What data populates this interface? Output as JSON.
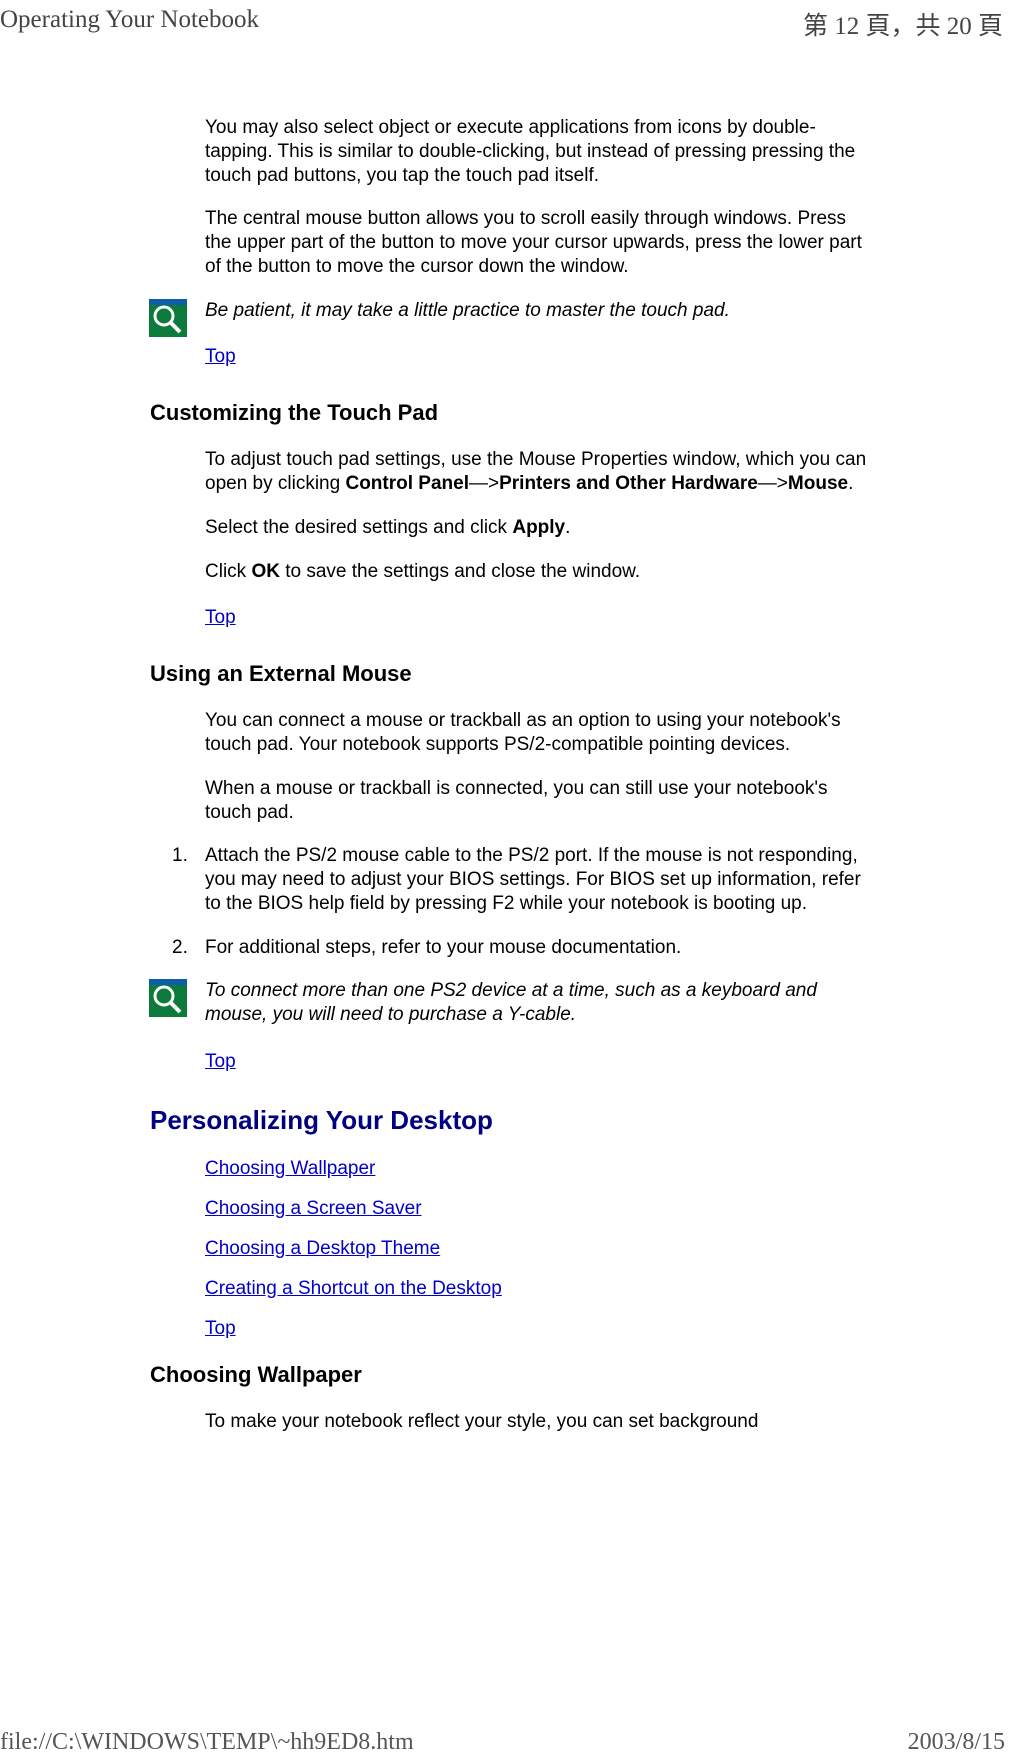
{
  "header": {
    "title": "Operating Your Notebook",
    "pageInfo": "第 12 頁，共 20 頁"
  },
  "intro": {
    "p1": "You may also select object or execute applications from icons by double-tapping. This is similar to double-clicking, but instead of pressing pressing the touch pad buttons, you tap the touch pad itself.",
    "p2": "The central mouse button allows you to scroll easily through windows. Press the upper part of the button to move your cursor upwards, press the lower part of the button to move the cursor down the window.",
    "note": "Be patient, it may take a little practice to master the touch pad.",
    "topLink": "Top"
  },
  "customizing": {
    "heading": "Customizing the Touch Pad",
    "p1_a": "To adjust touch pad settings, use the Mouse Properties window, which you can open by clicking ",
    "p1_b": "Control Panel",
    "p1_c": "—>",
    "p1_d": "Printers and Other Hardware",
    "p1_e": "—>",
    "p1_f": "Mouse",
    "p1_g": ".",
    "p2_a": "Select the desired settings and click ",
    "p2_b": "Apply",
    "p2_c": ".",
    "p3_a": "Click ",
    "p3_b": "OK",
    "p3_c": " to save the settings and close the window.",
    "topLink": "Top"
  },
  "externalMouse": {
    "heading": "Using an External Mouse",
    "p1": "You can connect a mouse or trackball as an option to using your notebook's touch pad. Your notebook supports PS/2-compatible pointing devices.",
    "p2": "When a mouse or trackball is connected, you can still use your notebook's touch pad.",
    "ol1": "Attach the PS/2 mouse cable to the PS/2 port. If the mouse is not responding, you may need to adjust your BIOS settings. For BIOS set up information, refer to the BIOS help field by pressing F2 while your notebook is booting up.",
    "ol2": "For additional steps, refer to your mouse documentation.",
    "note": "To connect more than one PS2 device at a time, such as a keyboard and mouse, you will need to purchase a Y-cable.",
    "topLink": "Top"
  },
  "personalizing": {
    "heading": "Personalizing Your Desktop",
    "links": {
      "wallpaper": "Choosing Wallpaper",
      "screensaver": "Choosing a Screen Saver",
      "theme": "Choosing a Desktop Theme",
      "shortcut": "Creating a Shortcut on the Desktop"
    },
    "topLink": "Top"
  },
  "wallpaper": {
    "heading": "Choosing Wallpaper",
    "p1": "To make your notebook reflect your style, you can set background"
  },
  "footer": {
    "path": "file://C:\\WINDOWS\\TEMP\\~hh9ED8.htm",
    "date": "2003/8/15"
  },
  "listNumbers": {
    "n1": "1.",
    "n2": "2."
  }
}
